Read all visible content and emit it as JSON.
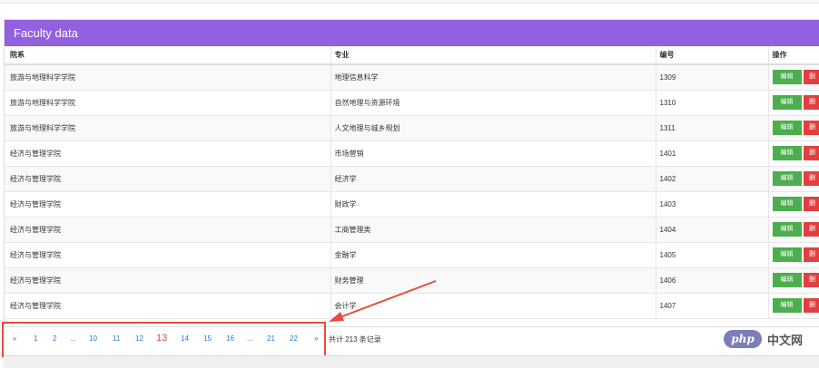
{
  "panel": {
    "title": "Faculty data"
  },
  "table": {
    "headers": {
      "dept": "院系",
      "major": "专业",
      "code": "编号",
      "ops": "操作"
    },
    "rows": [
      {
        "dept": "旅游与地理科学学院",
        "major": "地理信息科学",
        "code": "1309"
      },
      {
        "dept": "旅游与地理科学学院",
        "major": "自然地理与资源环境",
        "code": "1310"
      },
      {
        "dept": "旅游与地理科学学院",
        "major": "人文地理与城乡规划",
        "code": "1311"
      },
      {
        "dept": "经济与管理学院",
        "major": "市场营销",
        "code": "1401"
      },
      {
        "dept": "经济与管理学院",
        "major": "经济学",
        "code": "1402"
      },
      {
        "dept": "经济与管理学院",
        "major": "财政学",
        "code": "1403"
      },
      {
        "dept": "经济与管理学院",
        "major": "工商管理类",
        "code": "1404"
      },
      {
        "dept": "经济与管理学院",
        "major": "金融学",
        "code": "1405"
      },
      {
        "dept": "经济与管理学院",
        "major": "财务管理",
        "code": "1406"
      },
      {
        "dept": "经济与管理学院",
        "major": "会计学",
        "code": "1407"
      }
    ],
    "edit_label": "编辑",
    "delete_label": "删"
  },
  "pagination": {
    "prev": "«",
    "pages": [
      "1",
      "2",
      "...",
      "10",
      "11",
      "12",
      "13",
      "14",
      "15",
      "16",
      "...",
      "21",
      "22"
    ],
    "current": "13",
    "next": "»",
    "total_text": "共计 213 条记录"
  },
  "watermark": {
    "logo": "php",
    "text": "中文网"
  },
  "colors": {
    "header": "#9360e0",
    "edit": "#4cae4c",
    "delete": "#e04040",
    "highlight": "#e74c3c",
    "link": "#2a78c2"
  }
}
